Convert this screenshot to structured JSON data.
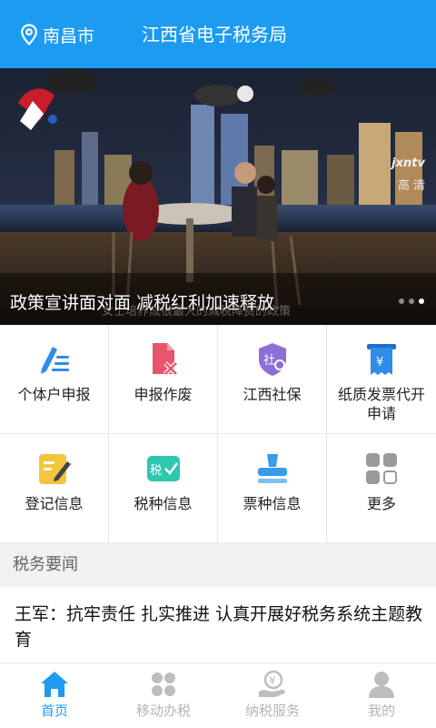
{
  "header": {
    "location": "南昌市",
    "title": "江西省电子税务局",
    "color": "#1d9bf0"
  },
  "banner": {
    "caption": "政策宣讲面对面 减税红利加速释放",
    "subcaption": "女士培养成很最大的减税降费的政策",
    "logo_right": "jxntv",
    "logo_right_sub": "高 清",
    "slide_count": 3,
    "active_slide": 3
  },
  "services": [
    {
      "label": "个体户申报",
      "icon": "pen-list-icon",
      "color": "#2f8ce8"
    },
    {
      "label": "申报作废",
      "icon": "document-cancel-icon",
      "color": "#e8566b"
    },
    {
      "label": "江西社保",
      "icon": "social-security-shield-icon",
      "color": "#8b6fd6"
    },
    {
      "label": "纸质发票代开申请",
      "icon": "invoice-yen-icon",
      "color": "#2f8ce8"
    },
    {
      "label": "登记信息",
      "icon": "registration-edit-icon",
      "color": "#f2c53d"
    },
    {
      "label": "税种信息",
      "icon": "tax-type-check-icon",
      "color": "#2ec7b0"
    },
    {
      "label": "票种信息",
      "icon": "stamp-icon",
      "color": "#3a9be8"
    },
    {
      "label": "更多",
      "icon": "more-grid-icon",
      "color": "#9a9a9a"
    }
  ],
  "section": {
    "title": "税务要闻"
  },
  "news": [
    {
      "title": "王军：抗牢责任 扎实推进 认真开展好税务系统主题教育"
    }
  ],
  "tabs": [
    {
      "label": "首页",
      "icon": "home-icon",
      "active": true
    },
    {
      "label": "移动办税",
      "icon": "apps-icon",
      "active": false
    },
    {
      "label": "纳税服务",
      "icon": "service-yen-icon",
      "active": false
    },
    {
      "label": "我的",
      "icon": "user-icon",
      "active": false
    }
  ]
}
